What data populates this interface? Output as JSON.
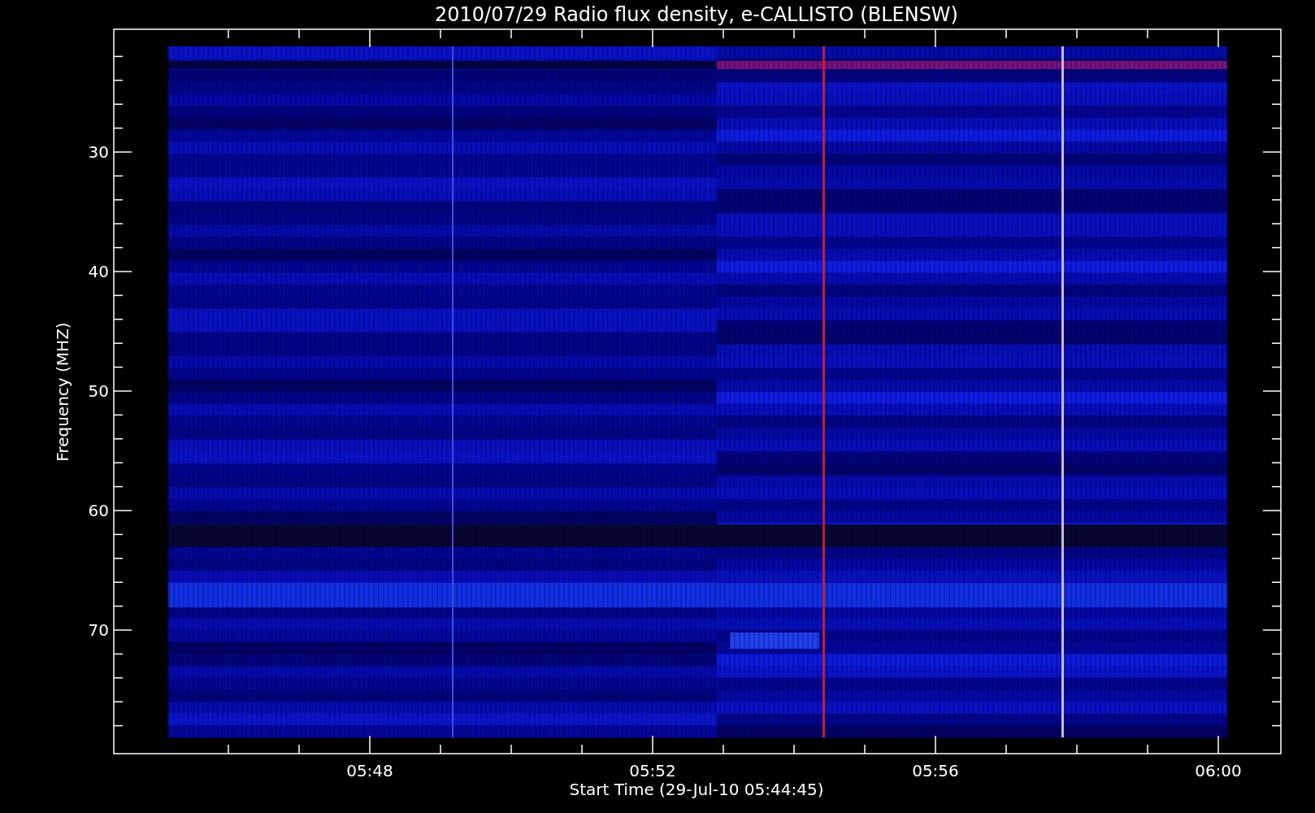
{
  "title": "2010/07/29  Radio flux density, e-CALLISTO (BLENSW)",
  "y_axis": {
    "label": "Frequency (MHZ)",
    "ticks": [
      "30",
      "40",
      "50",
      "60",
      "70"
    ]
  },
  "x_axis": {
    "label": "Start Time (29-Jul-10 05:44:45)",
    "ticks": [
      "05:48",
      "05:52",
      "05:56",
      "06:00"
    ]
  }
}
